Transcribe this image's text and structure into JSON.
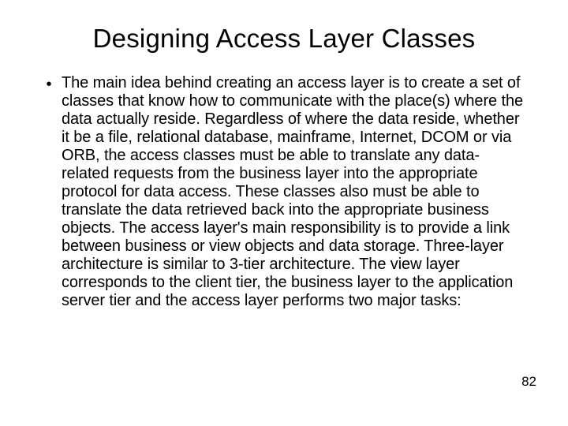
{
  "title": "Designing Access Layer Classes",
  "bullet_glyph": "•",
  "body_text": "The main idea behind creating an access layer is to create a set of classes that know how to communicate with the place(s) where the data actually reside.  Regardless of where the data reside, whether it be a file, relational database, mainframe, Internet, DCOM or via ORB, the access classes must be able to translate any data-related requests from the business layer into the appropriate protocol for data access.  These classes also must be able to translate the data retrieved back into the appropriate business objects.  The access layer's main responsibility is to provide a link between business or view objects and data storage.  Three-layer architecture is similar to 3-tier architecture.  The view layer corresponds to the client tier, the business layer to the application server tier and the access layer performs two major tasks:",
  "page_number": "82"
}
